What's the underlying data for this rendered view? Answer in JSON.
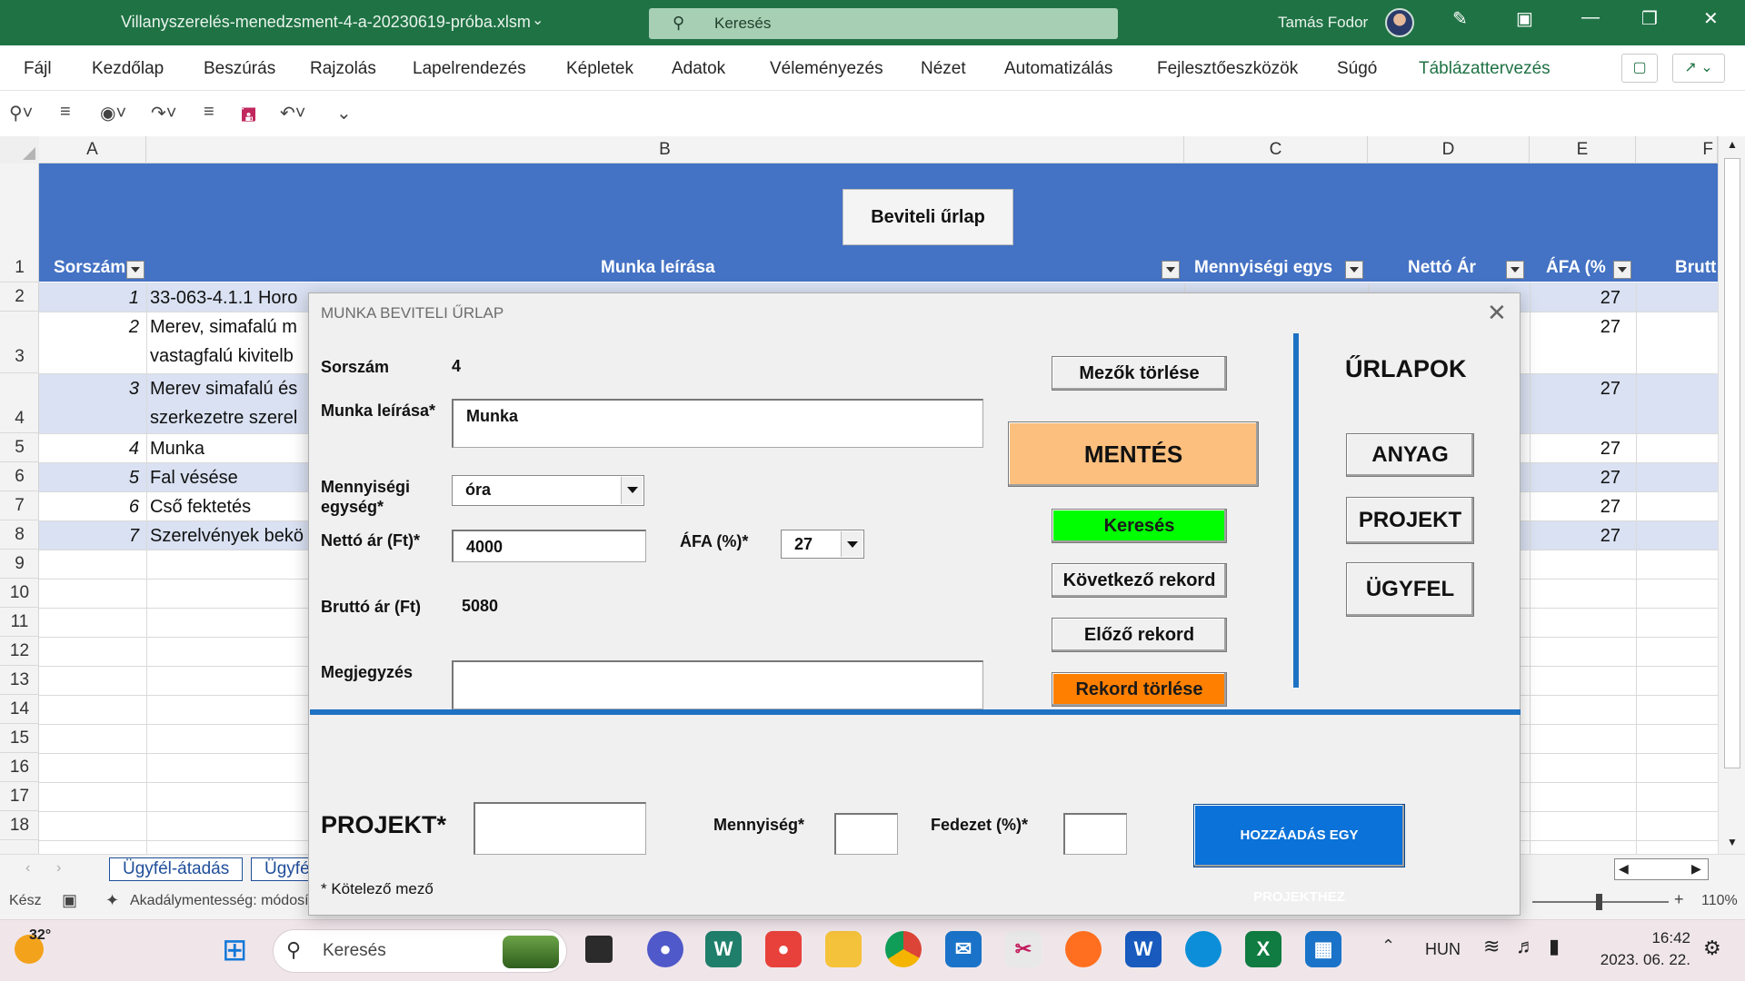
{
  "window": {
    "document_title": "Villanyszerelés-menedzsment-4-a-20230619-próba.xlsm",
    "search_placeholder": "Keresés",
    "user_name": "Tamás Fodor"
  },
  "ribbon": {
    "tabs": [
      "Fájl",
      "Kezdőlap",
      "Beszúrás",
      "Rajzolás",
      "Lapelrendezés",
      "Képletek",
      "Adatok",
      "Véleményezés",
      "Nézet",
      "Automatizálás",
      "Fejlesztőeszközök",
      "Súgó",
      "Táblázattervezés"
    ]
  },
  "sheet": {
    "columns": [
      "A",
      "B",
      "C",
      "D",
      "E",
      "F"
    ],
    "row_numbers": [
      "1",
      "2",
      "3",
      "4",
      "5",
      "6",
      "7",
      "8",
      "9",
      "10",
      "11",
      "12",
      "13",
      "14",
      "15",
      "16",
      "17",
      "18"
    ],
    "entry_button": "Beviteli űrlap",
    "headers": {
      "sorszam": "Sorszám",
      "munka": "Munka leírása",
      "menny": "Mennyiségi egys",
      "netto": "Nettó Ár",
      "afa": "ÁFA (%",
      "brutto": "Brutt"
    },
    "rows": [
      {
        "n": "1",
        "text": "33-063-4.1.1 Horo",
        "afa": "27"
      },
      {
        "n": "2",
        "text": "Merev, simafalú m",
        "text2": "vastagfalú kivitelb",
        "afa": "27"
      },
      {
        "n": "3",
        "text": "Merev simafalú és",
        "text2": "szerkezetre szerel",
        "afa": "27"
      },
      {
        "n": "4",
        "text": "Munka",
        "afa": "27"
      },
      {
        "n": "5",
        "text": "Fal vésése",
        "afa": "27"
      },
      {
        "n": "6",
        "text": "Cső fektetés",
        "afa": "27"
      },
      {
        "n": "7",
        "text": "Szerelvények bekö",
        "afa": "27"
      }
    ],
    "sheet_tabs": [
      "Ügyfél-átadás",
      "Ügyfé"
    ]
  },
  "status": {
    "ready": "Kész",
    "accessibility": "Akadálymentesség: módosít",
    "zoom": "110%"
  },
  "dialog": {
    "title": "MUNKA BEVITELI ŰRLAP",
    "sorszam_label": "Sorszám",
    "sorszam_value": "4",
    "munka_label": "Munka leírása*",
    "munka_value": "Munka",
    "menny_label": "Mennyiségi egység*",
    "menny_value": "óra",
    "netto_label": "Nettó ár (Ft)*",
    "netto_value": "4000",
    "afa_label": "ÁFA (%)*",
    "afa_value": "27",
    "brutto_label": "Bruttó ár (Ft)",
    "brutto_value": "5080",
    "megj_label": "Megjegyzés",
    "megj_value": "",
    "btn_clear": "Mezők törlése",
    "btn_save": "MENTÉS",
    "btn_search": "Keresés",
    "btn_next": "Következő rekord",
    "btn_prev": "Előző rekord",
    "btn_delete": "Rekord törlése",
    "forms_title": "ŰRLAPOK",
    "btn_anyag": "ANYAG",
    "btn_projekt": "PROJEKT",
    "btn_ugyfel": "ÜGYFEL",
    "projekt_label": "PROJEKT*",
    "mennyiseg_label": "Mennyiség*",
    "fedezet_label": "Fedezet (%)*",
    "btn_add": "HOZZÁADÁS EGY PROJEKTHEZ",
    "required_note": "* Kötelező mező",
    "colors": {
      "save": "#fcbf7e",
      "search": "#00ff00",
      "delete": "#ff8000",
      "accent": "#1e72c3"
    }
  },
  "taskbar": {
    "weather": "32°",
    "search_placeholder": "Keresés",
    "lang": "HUN",
    "time": "16:42",
    "date": "2023. 06. 22."
  }
}
